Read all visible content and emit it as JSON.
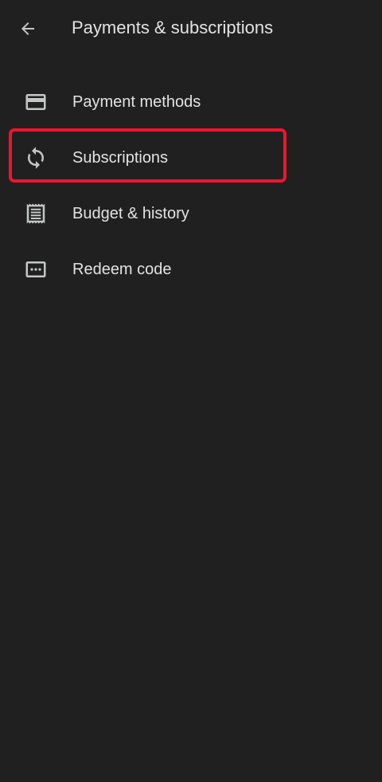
{
  "header": {
    "title": "Payments & subscriptions",
    "back_icon": "arrow-back-icon"
  },
  "menu": {
    "items": [
      {
        "label": "Payment methods",
        "icon": "credit-card-icon"
      },
      {
        "label": "Subscriptions",
        "icon": "sync-icon",
        "highlighted": true
      },
      {
        "label": "Budget & history",
        "icon": "receipt-icon"
      },
      {
        "label": "Redeem code",
        "icon": "redeem-code-icon"
      }
    ]
  },
  "colors": {
    "background": "#202020",
    "text": "#e3e3e3",
    "icon": "#c4c7c5",
    "highlight": "#f0142e"
  }
}
